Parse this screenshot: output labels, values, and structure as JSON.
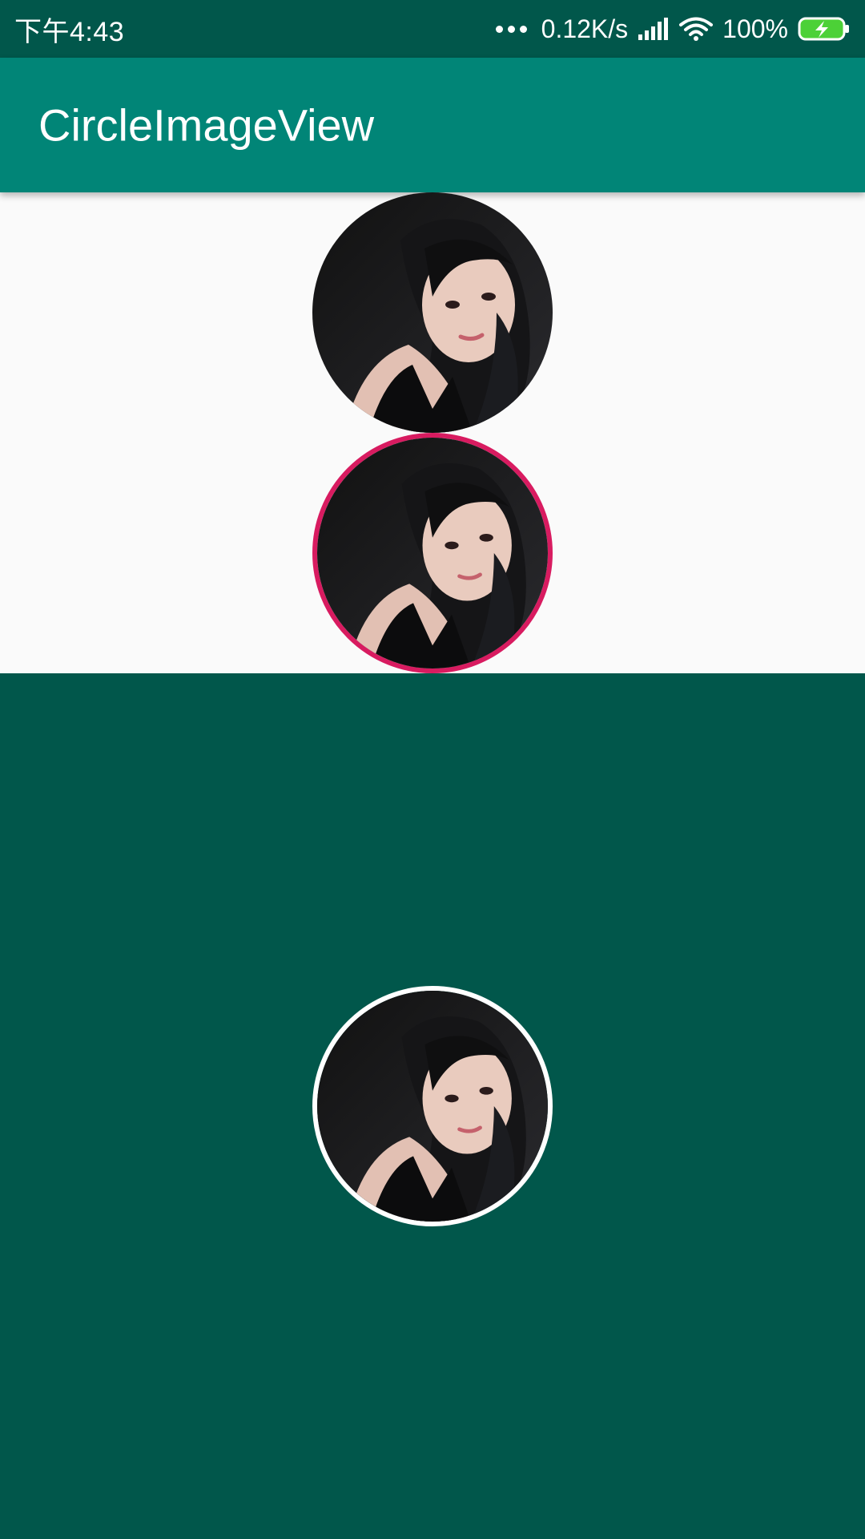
{
  "status_bar": {
    "time": "下午4:43",
    "network_speed": "0.12K/s",
    "battery_percent": "100%",
    "icons": [
      "more-dots-icon",
      "signal-icon",
      "wifi-icon",
      "battery-charging-icon"
    ]
  },
  "app_bar": {
    "title": "CircleImageView"
  },
  "avatars": [
    {
      "name": "avatar-plain",
      "border_color": null
    },
    {
      "name": "avatar-pink-border",
      "border_color": "#D81B60"
    },
    {
      "name": "avatar-white-border",
      "border_color": "#FFFFFF"
    }
  ],
  "colors": {
    "status_bar": "#01574B",
    "app_bar": "#018577",
    "content_light": "#FAFAFA",
    "background_dark": "#01574B",
    "battery_fill": "#4CD137"
  }
}
